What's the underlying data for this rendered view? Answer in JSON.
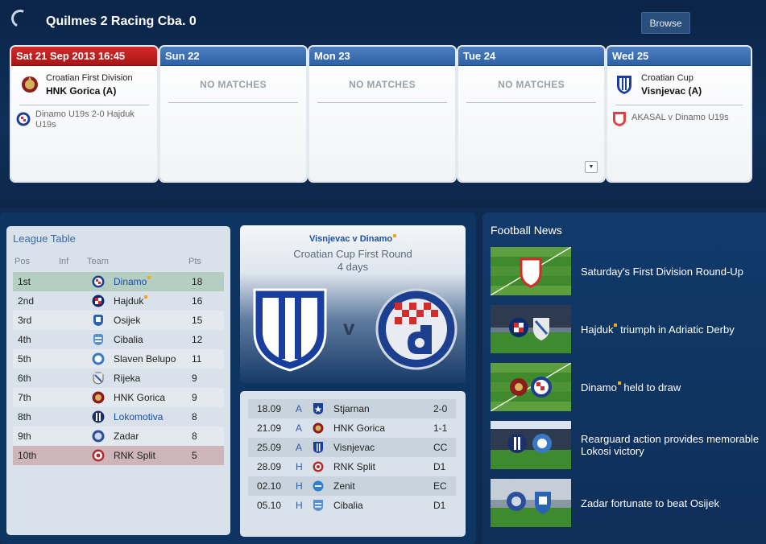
{
  "header": {
    "title": "Quilmes 2 Racing Cba. 0",
    "browse_label": "Browse"
  },
  "calendar": [
    {
      "label": "Sat 21 Sep 2013 16:45",
      "active": true,
      "competition": "Croatian First Division",
      "opponent": "HNK Gorica (A)",
      "other": "Dinamo U19s 2-0 Hajduk U19s"
    },
    {
      "label": "Sun 22",
      "no_matches": "NO MATCHES"
    },
    {
      "label": "Mon 23",
      "no_matches": "NO MATCHES"
    },
    {
      "label": "Tue 24",
      "no_matches": "NO MATCHES"
    },
    {
      "label": "Wed 25",
      "competition": "Croatian Cup",
      "opponent": "Visnjevac (A)",
      "other": "AKASAL v Dinamo U19s"
    }
  ],
  "league_table": {
    "title": "League Table",
    "columns": [
      "Pos",
      "Inf",
      "Team",
      "Pts"
    ],
    "rows": [
      {
        "pos": "1st",
        "team": "Dinamo",
        "pts": "18",
        "link": true,
        "star": true
      },
      {
        "pos": "2nd",
        "team": "Hajduk",
        "pts": "16",
        "star": true
      },
      {
        "pos": "3rd",
        "team": "Osijek",
        "pts": "15"
      },
      {
        "pos": "4th",
        "team": "Cibalia",
        "pts": "12"
      },
      {
        "pos": "5th",
        "team": "Slaven Belupo",
        "pts": "11"
      },
      {
        "pos": "6th",
        "team": "Rijeka",
        "pts": "9"
      },
      {
        "pos": "7th",
        "team": "HNK Gorica",
        "pts": "9"
      },
      {
        "pos": "8th",
        "team": "Lokomotiva",
        "pts": "8",
        "link": true
      },
      {
        "pos": "9th",
        "team": "Zadar",
        "pts": "8"
      },
      {
        "pos": "10th",
        "team": "RNK Split",
        "pts": "5"
      }
    ]
  },
  "next_match": {
    "fixture": "Visnjevac v Dinamo",
    "competition": "Croatian Cup First Round",
    "days": "4 days",
    "vs": "v"
  },
  "fixtures": [
    {
      "date": "18.09",
      "venue": "A",
      "team": "Stjarnan",
      "result": "2-0"
    },
    {
      "date": "21.09",
      "venue": "A",
      "team": "HNK Gorica",
      "result": "1-1"
    },
    {
      "date": "25.09",
      "venue": "A",
      "team": "Visnjevac",
      "result": "CC"
    },
    {
      "date": "28.09",
      "venue": "H",
      "team": "RNK Split",
      "result": "D1"
    },
    {
      "date": "02.10",
      "venue": "H",
      "team": "Zenit",
      "result": "EC"
    },
    {
      "date": "05.10",
      "venue": "H",
      "team": "Cibalia",
      "result": "D1"
    }
  ],
  "news": {
    "title": "Football News",
    "items": [
      {
        "headline": "Saturday's First Division Round-Up"
      },
      {
        "headline": "Hajduk triumph in Adriatic Derby",
        "star_after": "Hajduk"
      },
      {
        "headline": "Dinamo held to draw",
        "star_after": "Dinamo"
      },
      {
        "headline": "Rearguard action provides memorable Lokosi victory"
      },
      {
        "headline": "Zadar fortunate to beat Osijek"
      }
    ]
  }
}
